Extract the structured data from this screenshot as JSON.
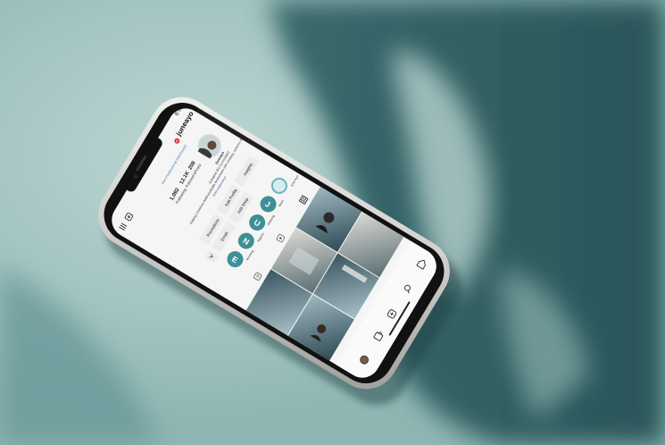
{
  "colors": {
    "carpet_light": "#a9c9c6",
    "carpet_mid": "#6f9d9c",
    "carpet_shadow": "#2f5f63",
    "phone_frame": "#d8d8d6",
    "screen_bg": "#f5f5f5",
    "accent_teal": "#3e8f96",
    "notification_red": "#e0304a"
  },
  "status_bar": {
    "time": "8:56"
  },
  "profile": {
    "username": "juneayo",
    "notification_count": "9",
    "dashboard_link": "See Professional Dashboard",
    "stats": [
      {
        "value": "208",
        "label": "Posts"
      },
      {
        "value": "12.1K",
        "label": "Followers"
      },
      {
        "value": "1,092",
        "label": "Following"
      }
    ],
    "bio": [
      "Juneayo",
      "Creative Biz Consultant",
      "Helping Creatives build profitable businesses with strategy, systems &",
      "linktr.ee/juneayo"
    ]
  },
  "buttons": {
    "insights": "Insights",
    "edit_profile": "Edit Profile",
    "promotions": "Promotions",
    "add_shop": "Add Shop",
    "email": "Email"
  },
  "highlights": [
    {
      "letter": "",
      "label": "June Ayo"
    },
    {
      "letter": "J",
      "label": "Work"
    },
    {
      "letter": "U",
      "label": "Working"
    },
    {
      "letter": "N",
      "label": "Nigeria"
    },
    {
      "letter": "E",
      "label": "Working"
    }
  ],
  "icons": {
    "menu": "hamburger-menu-icon",
    "add": "add-post-icon",
    "grid": "grid-tab-icon",
    "tagged": "tagged-tab-icon",
    "reels": "reels-tab-icon",
    "home": "home-icon",
    "search": "search-icon",
    "add_tab": "add-tab-icon",
    "shop": "shop-icon",
    "profile": "profile-icon"
  }
}
